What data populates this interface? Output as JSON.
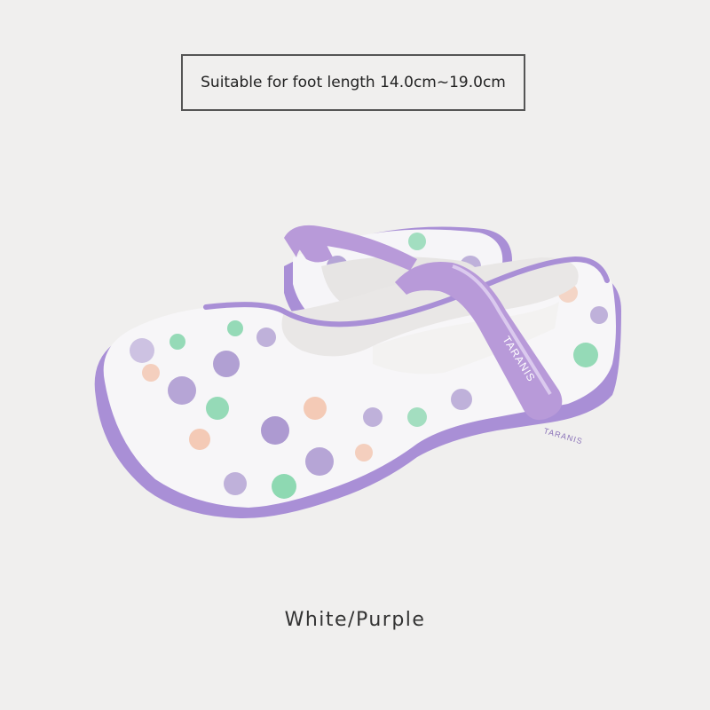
{
  "size_note": "Suitable for foot length 14.0cm~19.0cm",
  "color_caption": "White/Purple",
  "brand_logo_text": "TARANIS",
  "colors": {
    "background": "#f0efee",
    "sole": "#a98fd6",
    "strap": "#b89ad9",
    "upper": "#f7f6f8",
    "dot_purple": "#9a83c7",
    "dot_green": "#6bcf9b",
    "dot_peach": "#f2bfa5"
  }
}
